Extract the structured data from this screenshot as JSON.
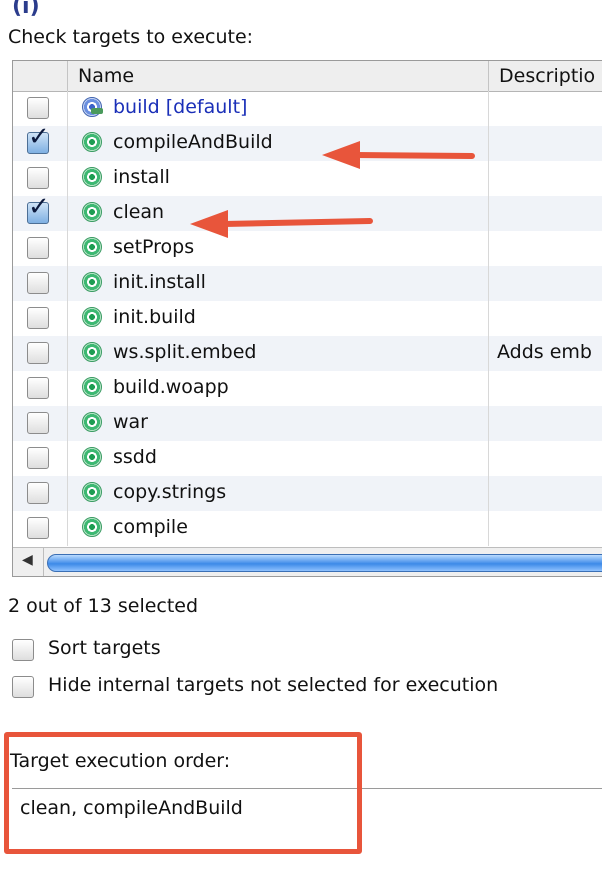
{
  "top_glyph": "(i)",
  "heading": "Check targets to execute:",
  "columns": {
    "name": "Name",
    "description": "Descriptio"
  },
  "targets": [
    {
      "name": "build [default]",
      "checked": false,
      "is_default": true,
      "description": ""
    },
    {
      "name": "compileAndBuild",
      "checked": true,
      "is_default": false,
      "description": ""
    },
    {
      "name": "install",
      "checked": false,
      "is_default": false,
      "description": ""
    },
    {
      "name": "clean",
      "checked": true,
      "is_default": false,
      "description": ""
    },
    {
      "name": "setProps",
      "checked": false,
      "is_default": false,
      "description": ""
    },
    {
      "name": "init.install",
      "checked": false,
      "is_default": false,
      "description": ""
    },
    {
      "name": "init.build",
      "checked": false,
      "is_default": false,
      "description": ""
    },
    {
      "name": "ws.split.embed",
      "checked": false,
      "is_default": false,
      "description": "Adds emb"
    },
    {
      "name": "build.woapp",
      "checked": false,
      "is_default": false,
      "description": ""
    },
    {
      "name": "war",
      "checked": false,
      "is_default": false,
      "description": ""
    },
    {
      "name": "ssdd",
      "checked": false,
      "is_default": false,
      "description": ""
    },
    {
      "name": "copy.strings",
      "checked": false,
      "is_default": false,
      "description": ""
    },
    {
      "name": "compile",
      "checked": false,
      "is_default": false,
      "description": ""
    }
  ],
  "selection_count": "2 out of 13 selected",
  "options": {
    "sort_targets": {
      "label": "Sort targets",
      "checked": false
    },
    "hide_internal": {
      "label": "Hide internal targets not selected for execution",
      "checked": false
    }
  },
  "order": {
    "label": "Target execution order:",
    "value": "clean, compileAndBuild"
  },
  "colors": {
    "annotation": "#e8553b",
    "scroll_thumb": "#3d8ae8",
    "default_target": "#1a2fb8"
  }
}
